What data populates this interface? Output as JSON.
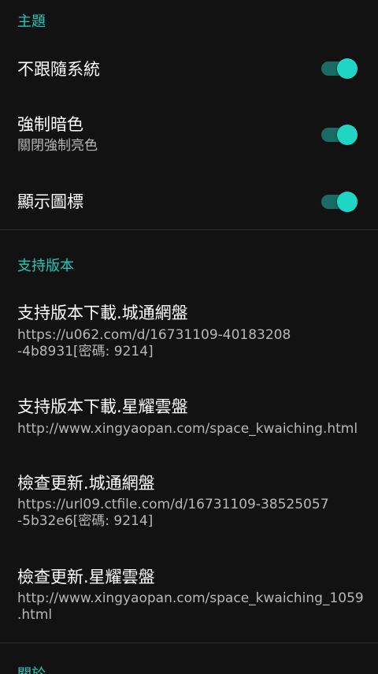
{
  "colors": {
    "background": "#121212",
    "accent": "#1ec9b8",
    "switch_thumb": "#1ed6c3",
    "switch_track": "#1a6b63",
    "title_text": "#ffffff",
    "summary_text": "#b8b8b8",
    "divider": "#2e2e2e"
  },
  "theme_section": {
    "header": "主題",
    "items": [
      {
        "title": "不跟隨系統",
        "summary": "",
        "switch_on": true
      },
      {
        "title": "強制暗色",
        "summary": "關閉強制亮色",
        "switch_on": true
      },
      {
        "title": "顯示圖標",
        "summary": "",
        "switch_on": true
      }
    ]
  },
  "support_section": {
    "header": "支持版本",
    "items": [
      {
        "title": "支持版本下載.城通網盤",
        "summary": "https://u062.com/d/16731109-40183208\n-4b8931[密碼: 9214]"
      },
      {
        "title": "支持版本下載.星耀雲盤",
        "summary": "http://www.xingyaopan.com/space_kwaiching.html"
      },
      {
        "title": "檢查更新.城通網盤",
        "summary": "https://url09.ctfile.com/d/16731109-38525057\n-5b32e6[密碼: 9214]"
      },
      {
        "title": "檢查更新.星耀雲盤",
        "summary": "http://www.xingyaopan.com/space_kwaiching_1059\n.html"
      }
    ]
  },
  "next_section": {
    "header": "關於"
  }
}
